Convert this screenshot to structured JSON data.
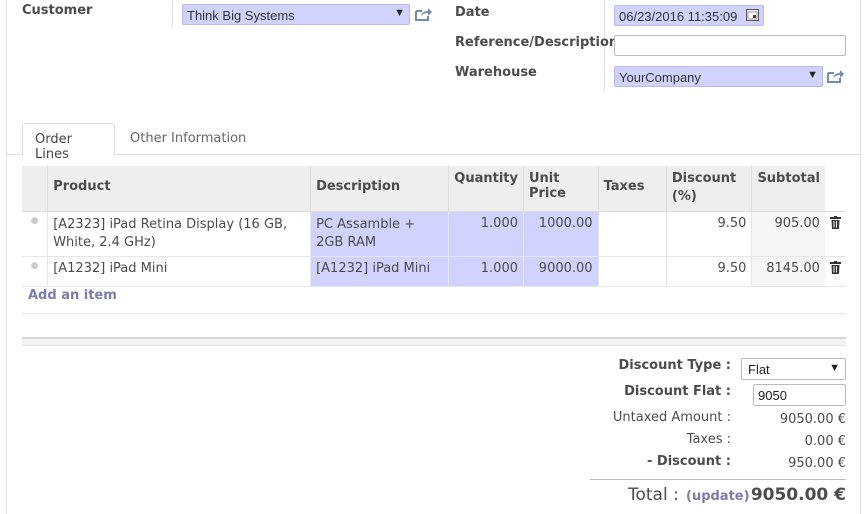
{
  "header": {
    "customer_label": "Customer",
    "customer_value": "Think Big Systems",
    "date_label": "Date",
    "date_value": "06/23/2016 11:35:09",
    "reference_label": "Reference/Description",
    "reference_value": "",
    "warehouse_label": "Warehouse",
    "warehouse_value": "YourCompany"
  },
  "tabs": [
    {
      "label": "Order Lines",
      "active": true
    },
    {
      "label": "Other Information",
      "active": false
    }
  ],
  "table": {
    "columns": [
      "Product",
      "Description",
      "Quantity",
      "Unit Price",
      "Taxes",
      "Discount (%)",
      "Subtotal"
    ],
    "rows": [
      {
        "product": "[A2323] iPad Retina Display (16 GB, White, 2.4 GHz)",
        "description": "PC Assamble + 2GB RAM",
        "quantity": "1.000",
        "unit_price": "1000.00",
        "taxes": "",
        "discount": "9.50",
        "subtotal": "905.00"
      },
      {
        "product": "[A1232] iPad Mini",
        "description": "[A1232] iPad Mini",
        "quantity": "1.000",
        "unit_price": "9000.00",
        "taxes": "",
        "discount": "9.50",
        "subtotal": "8145.00"
      }
    ],
    "add_item": "Add an item"
  },
  "summary": {
    "discount_type_label": "Discount Type :",
    "discount_type_value": "Flat",
    "discount_flat_label": "Discount Flat :",
    "discount_flat_value": "9050",
    "untaxed_label": "Untaxed Amount :",
    "untaxed_value": "9050.00 €",
    "taxes_label": "Taxes :",
    "taxes_value": "0.00 €",
    "discount_label": "- Discount :",
    "discount_value": "950.00 €",
    "total_label": "Total :",
    "update_label": "(update)",
    "total_value": "9050.00 €"
  },
  "colors": {
    "highlight": "#d2d2ff",
    "link": "#7c7bad",
    "icon": "#6d8db5"
  },
  "icons": [
    "external-link-icon",
    "calendar-icon",
    "trash-icon",
    "drag-handle-icon",
    "chevron-down-icon"
  ]
}
